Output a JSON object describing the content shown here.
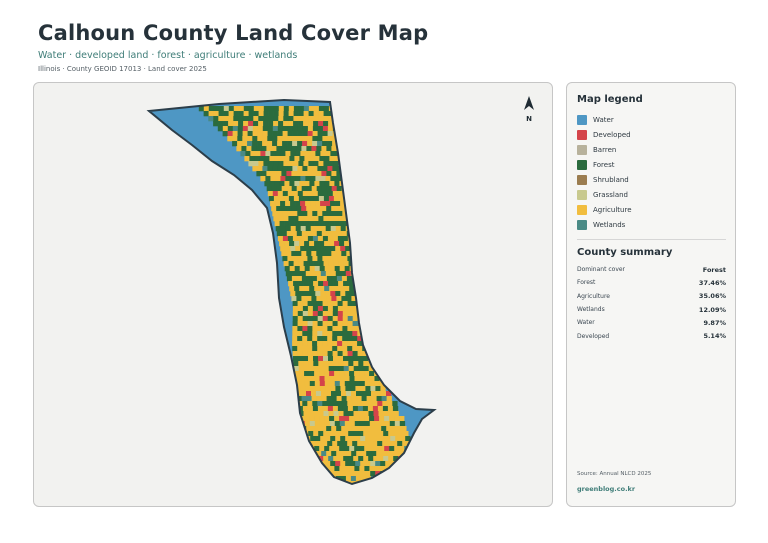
{
  "header": {
    "title": "Calhoun County Land Cover Map",
    "subtitle": "Water · developed land · forest · agriculture · wetlands",
    "meta": "Illinois · County GEOID 17013 · Land cover 2025"
  },
  "map": {
    "north_label": "N",
    "colors": {
      "water": "#4e97c4",
      "developed": "#d4444a",
      "barren": "#b8b29c",
      "forest": "#2b6b3e",
      "shrubland": "#9b7d50",
      "grassland": "#c8c98e",
      "agriculture": "#f1bd3e",
      "wetlands": "#4a8a85",
      "outline": "#2c3e4a",
      "background": "#f2f2f0"
    }
  },
  "legend": {
    "title": "Map legend",
    "items": [
      {
        "label": "Water",
        "color": "#4e97c4"
      },
      {
        "label": "Developed",
        "color": "#d4444a"
      },
      {
        "label": "Barren",
        "color": "#b8b29c"
      },
      {
        "label": "Forest",
        "color": "#2b6b3e"
      },
      {
        "label": "Shrubland",
        "color": "#9b7d50"
      },
      {
        "label": "Grassland",
        "color": "#c8c98e"
      },
      {
        "label": "Agriculture",
        "color": "#f1bd3e"
      },
      {
        "label": "Wetlands",
        "color": "#4a8a85"
      }
    ]
  },
  "summary": {
    "title": "County summary",
    "rows": [
      {
        "label": "Dominant cover",
        "value": "Forest"
      },
      {
        "label": "Forest",
        "value": "37.46%"
      },
      {
        "label": "Agriculture",
        "value": "35.06%"
      },
      {
        "label": "Wetlands",
        "value": "12.09%"
      },
      {
        "label": "Water",
        "value": "9.87%"
      },
      {
        "label": "Developed",
        "value": "5.14%"
      }
    ]
  },
  "footer": {
    "source": "Source: Annual NLCD 2025",
    "site": "greenblog.co.kr"
  }
}
